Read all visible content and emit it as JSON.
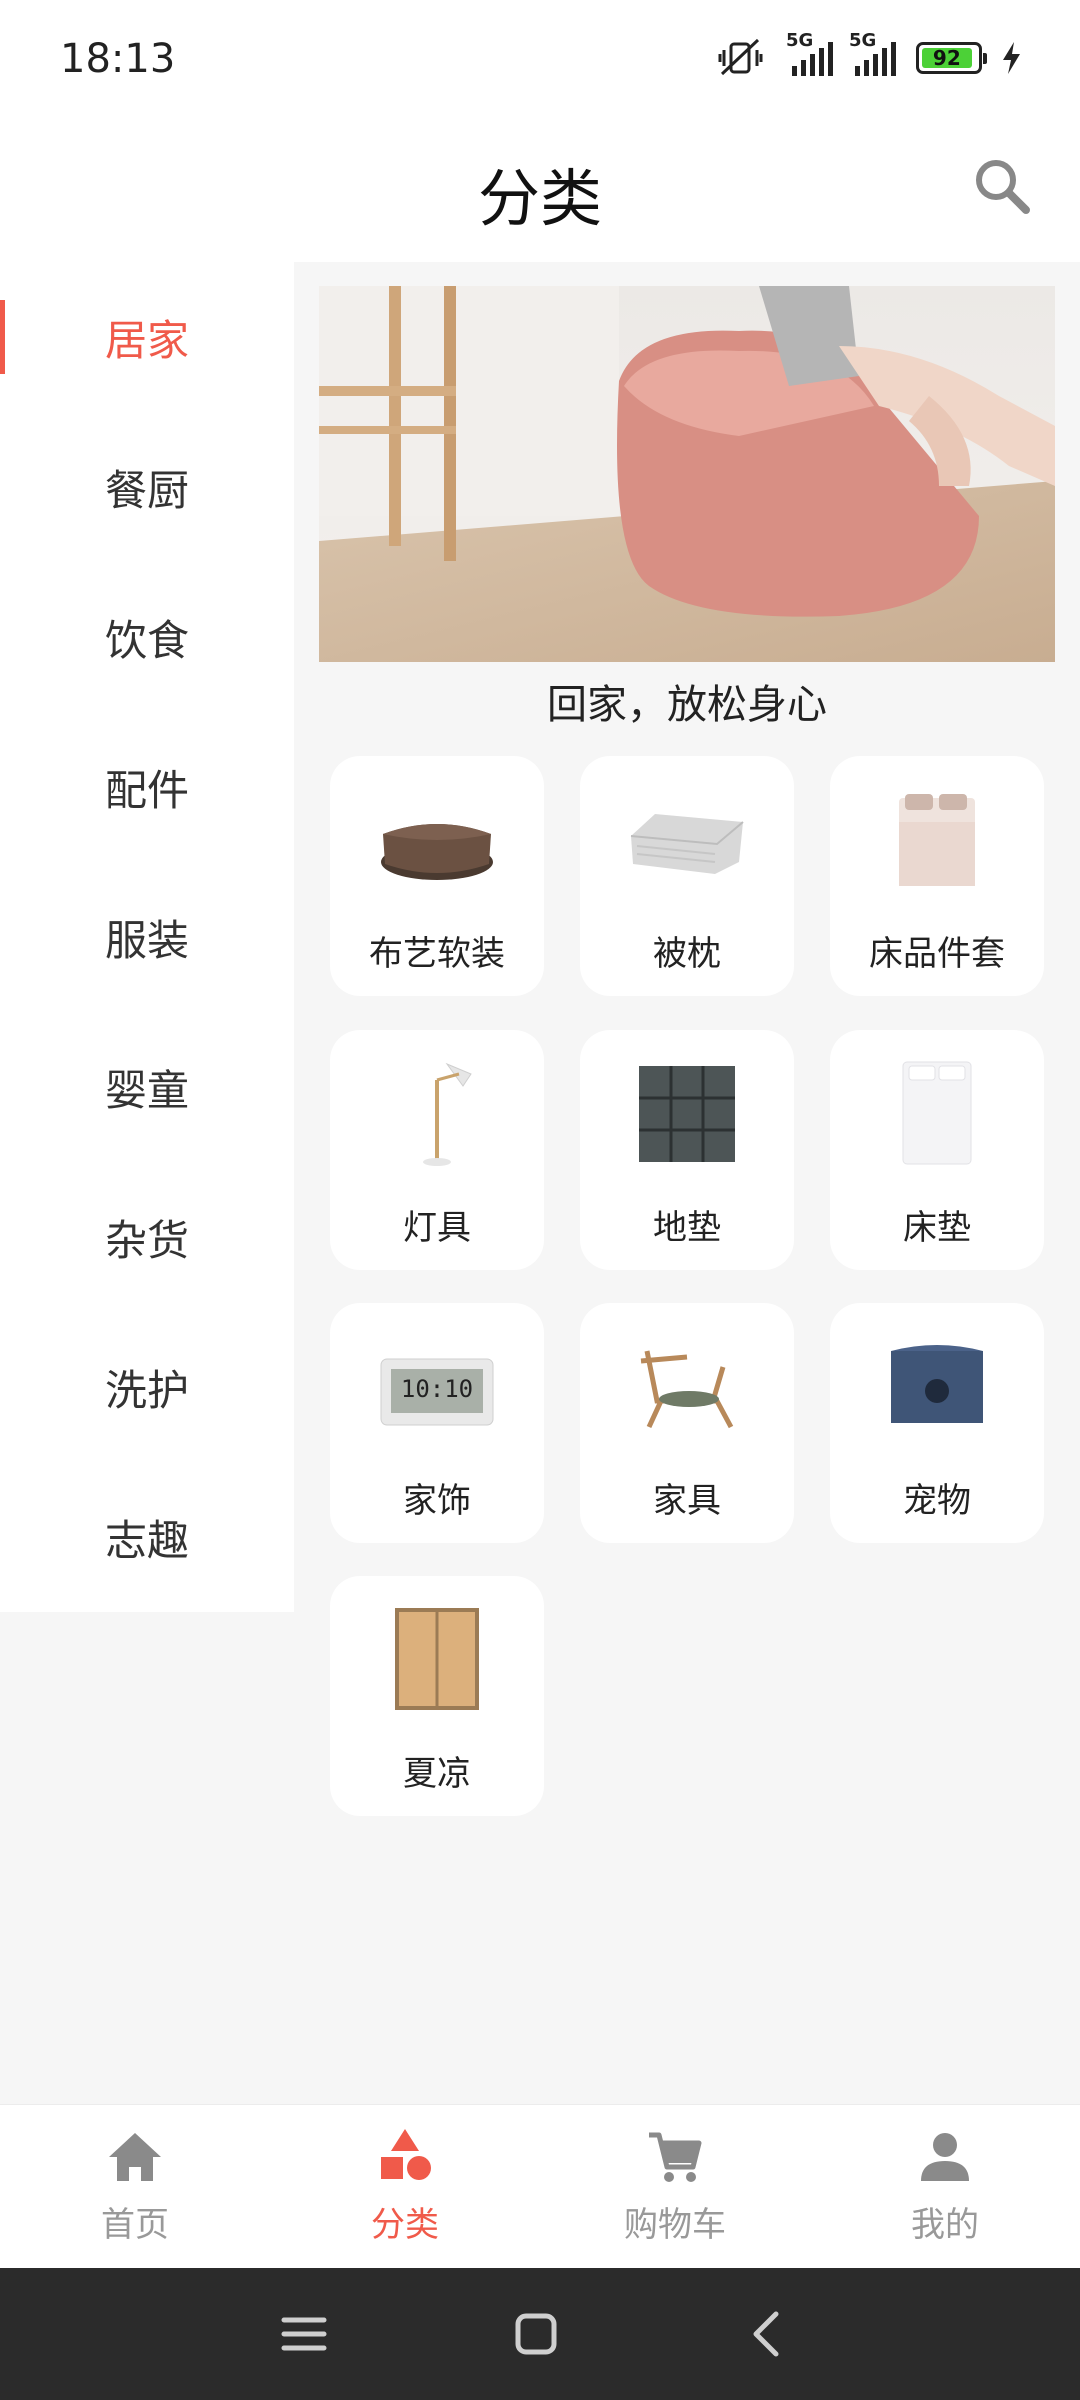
{
  "status_bar": {
    "time": "18:13",
    "network_labels": [
      "5G",
      "5G"
    ],
    "battery": "92",
    "icons": [
      "mute-vibrate-icon",
      "signal-icon",
      "signal-icon",
      "battery-icon",
      "charging-icon"
    ]
  },
  "header": {
    "title": "分类",
    "search_icon": "search-icon"
  },
  "sidebar": {
    "items": [
      {
        "label": "居家",
        "active": true
      },
      {
        "label": "餐厨",
        "active": false
      },
      {
        "label": "饮食",
        "active": false
      },
      {
        "label": "配件",
        "active": false
      },
      {
        "label": "服装",
        "active": false
      },
      {
        "label": "婴童",
        "active": false
      },
      {
        "label": "杂货",
        "active": false
      },
      {
        "label": "洗护",
        "active": false
      },
      {
        "label": "志趣",
        "active": false
      }
    ]
  },
  "banner": {
    "caption": "回家，放松身心"
  },
  "categories": [
    {
      "label": "布艺软装",
      "icon": "beanbag-icon"
    },
    {
      "label": "被枕",
      "icon": "quilt-icon"
    },
    {
      "label": "床品件套",
      "icon": "bedding-set-icon"
    },
    {
      "label": "灯具",
      "icon": "floor-lamp-icon"
    },
    {
      "label": "地垫",
      "icon": "floor-mat-icon"
    },
    {
      "label": "床垫",
      "icon": "mattress-icon"
    },
    {
      "label": "家饰",
      "icon": "digital-clock-icon"
    },
    {
      "label": "家具",
      "icon": "lounge-chair-icon"
    },
    {
      "label": "宠物",
      "icon": "pet-house-icon"
    },
    {
      "label": "夏凉",
      "icon": "summer-mat-icon"
    }
  ],
  "bottom_nav": {
    "items": [
      {
        "label": "首页",
        "icon": "home-icon",
        "active": false
      },
      {
        "label": "分类",
        "icon": "category-icon",
        "active": true
      },
      {
        "label": "购物车",
        "icon": "cart-icon",
        "active": false
      },
      {
        "label": "我的",
        "icon": "profile-icon",
        "active": false
      }
    ]
  },
  "colors": {
    "accent": "#f05a4a",
    "inactive": "#999999",
    "background": "#f6f6f6"
  }
}
